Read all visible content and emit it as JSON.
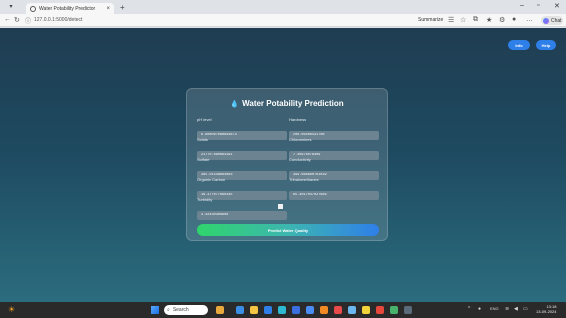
{
  "browser": {
    "tab_title": "Water Potability Predictor",
    "tab_close": "×",
    "new_tab": "+",
    "url": "127.0.0.1:5000/detect",
    "summarize_label": "Summarize",
    "profile_label": "Chat"
  },
  "header": {
    "left_button": "Info",
    "right_button": "Help"
  },
  "form": {
    "title": "Water Potability Prediction",
    "fields": [
      {
        "label": "pH level",
        "value": "6.608097088894674"
      },
      {
        "label": "Hardness",
        "value": "208.66406431708"
      },
      {
        "label": "Solids",
        "value": "21770.890864191"
      },
      {
        "label": "Chloramines",
        "value": "7.40976078409"
      },
      {
        "label": "Sulfate",
        "value": "365.01548694803"
      },
      {
        "label": "Conductivity",
        "value": "399.668860761039"
      },
      {
        "label": "Organic Carbon",
        "value": "16.377077090345"
      },
      {
        "label": "Trihalomethanes",
        "value": "65.3017047027689"
      },
      {
        "label": "Turbidity",
        "value": "3.42430308908"
      }
    ],
    "submit_label": "Predict Water Quality"
  },
  "taskbar": {
    "search_placeholder": "Search",
    "clock_time": "13:18",
    "clock_date": "13-09-2024",
    "lang": "ENG"
  }
}
